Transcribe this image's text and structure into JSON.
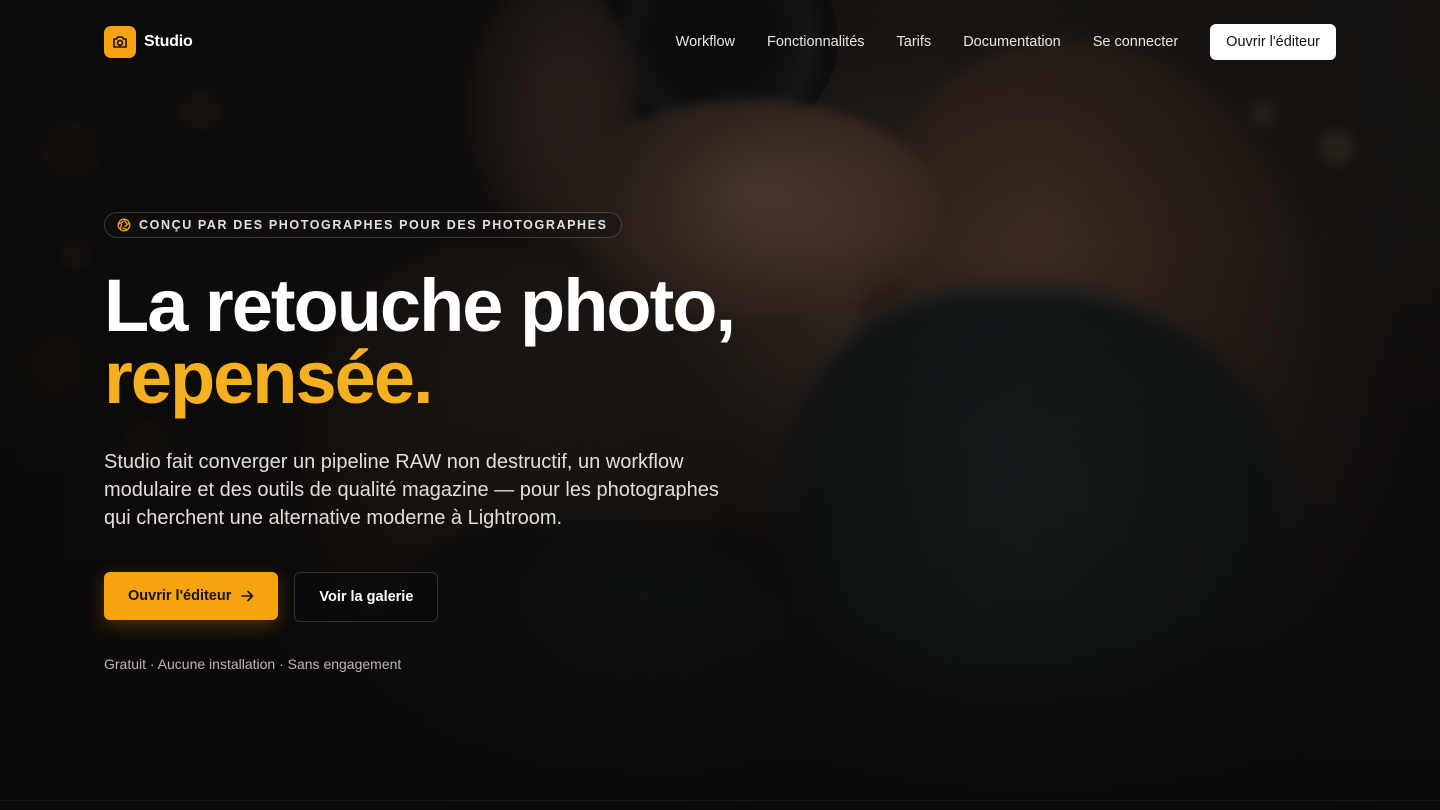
{
  "nav": {
    "brand_name": "Studio",
    "brand_icon": "camera-icon",
    "links": [
      "Workflow",
      "Fonctionnalités",
      "Tarifs",
      "Documentation",
      "Se connecter"
    ],
    "cta_label": "Ouvrir l'éditeur"
  },
  "hero": {
    "eyebrow_icon": "aperture-icon",
    "eyebrow": "CONÇU PAR DES PHOTOGRAPHES POUR DES PHOTOGRAPHES",
    "headline_line1": "La retouche photo,",
    "headline_line2": "repensée.",
    "lead": "Studio fait converger un pipeline RAW non destructif, un workflow modulaire et des outils de qualité magazine — pour les photographes qui cherchent une alternative moderne à Lightroom.",
    "primary_cta": "Ouvrir l'éditeur",
    "primary_cta_icon": "arrow-right-icon",
    "secondary_cta": "Voir la galerie",
    "fineprint": "Gratuit · Aucune installation · Sans engagement"
  },
  "colors": {
    "accent": "#f5a30f",
    "headline_accent": "#f5b021",
    "background": "#0b0a09"
  }
}
